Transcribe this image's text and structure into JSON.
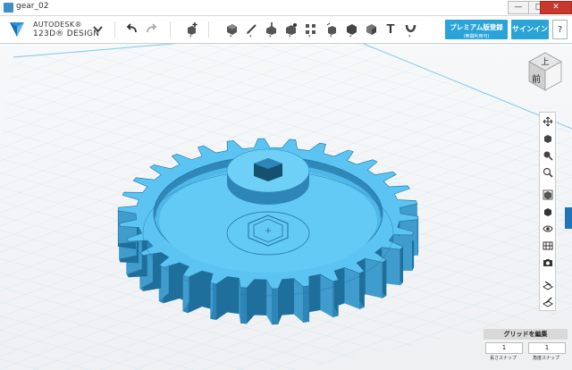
{
  "window": {
    "title": "gear_02",
    "minimize": "—",
    "maximize": "□",
    "close": "✕"
  },
  "brand": {
    "line1": "AUTODESK®",
    "line2": "123D® DESIGN"
  },
  "toolbar": {
    "undo_icon": "undo-arrow-icon",
    "redo_icon": "redo-arrow-icon",
    "text_tool_label": "T",
    "premium_label": "プレミアム版登録",
    "premium_sub": "(無償利用可)",
    "signin_label": "サインイン",
    "help_label": "?"
  },
  "navcube": {
    "top_face": "上",
    "front_face": "前"
  },
  "grid_panel": {
    "title": "グリッドを編集",
    "length_snap_value": "1",
    "angle_snap_value": "1",
    "length_snap_label": "長さスナップ",
    "angle_snap_label": "角度スナップ"
  },
  "colors": {
    "accent": "#29a3d8",
    "gear_top": "#5cc4f3",
    "gear_side": "#2e86b8",
    "gear_dark": "#1f6f9c"
  }
}
